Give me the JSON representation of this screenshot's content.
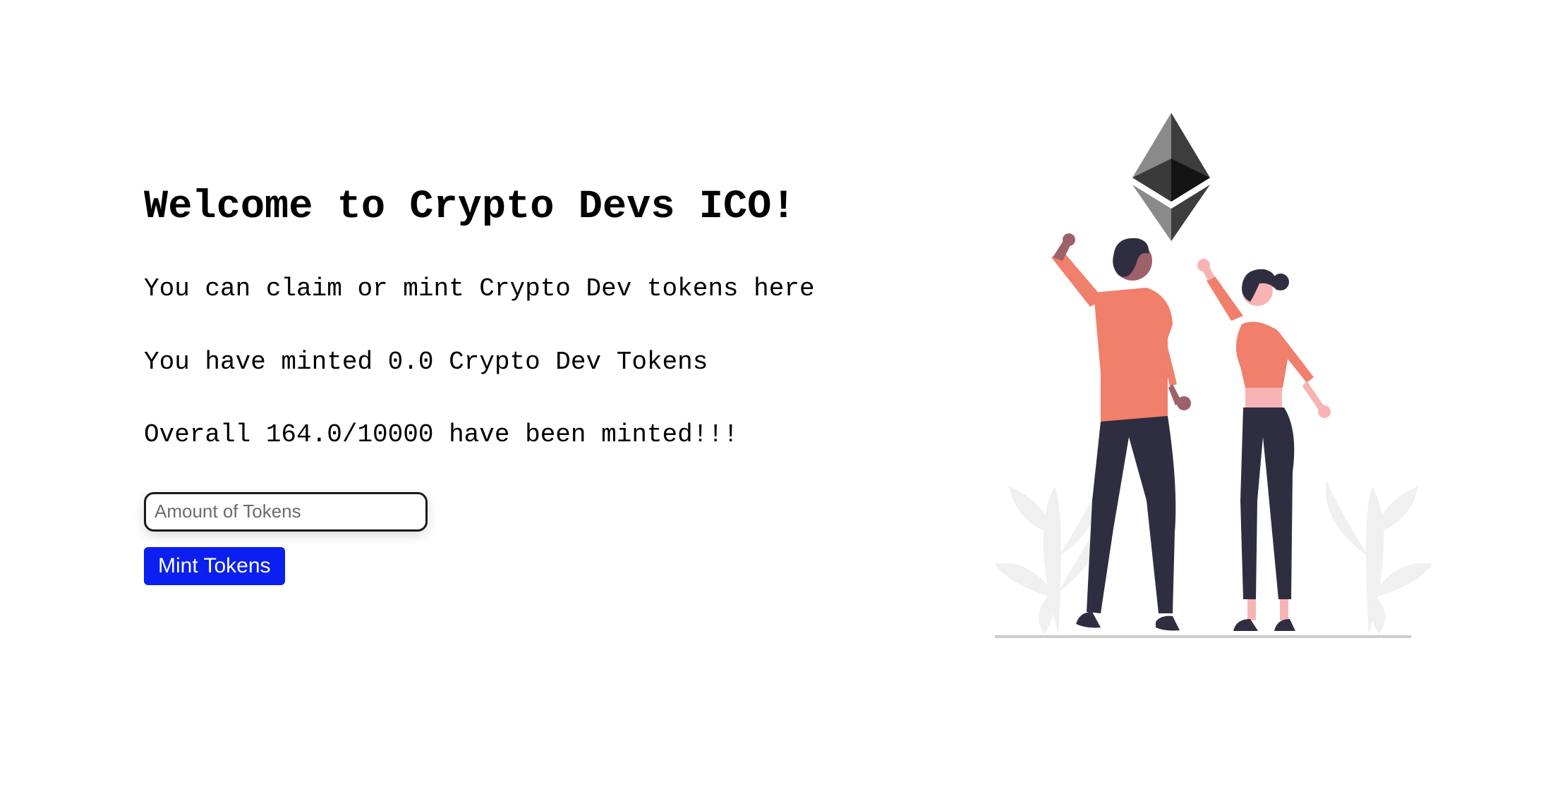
{
  "hero": {
    "title": "Welcome to Crypto Devs ICO!",
    "subtitle": "You can claim or mint Crypto Dev tokens here",
    "minted_by_user": "You have minted 0.0 Crypto Dev Tokens",
    "overall_minted": "Overall 164.0/10000 have been minted!!!"
  },
  "mint_form": {
    "amount_placeholder": "Amount of Tokens",
    "amount_value": "",
    "mint_button_label": "Mint Tokens"
  },
  "colors": {
    "button_bg": "#0a1ff0",
    "accent_coral": "#f07f6b",
    "dark_clothing": "#2f2e41"
  },
  "icons": {
    "illustration": "people-cheering-ethereum-illustration",
    "logo": "ethereum-logo-icon"
  }
}
